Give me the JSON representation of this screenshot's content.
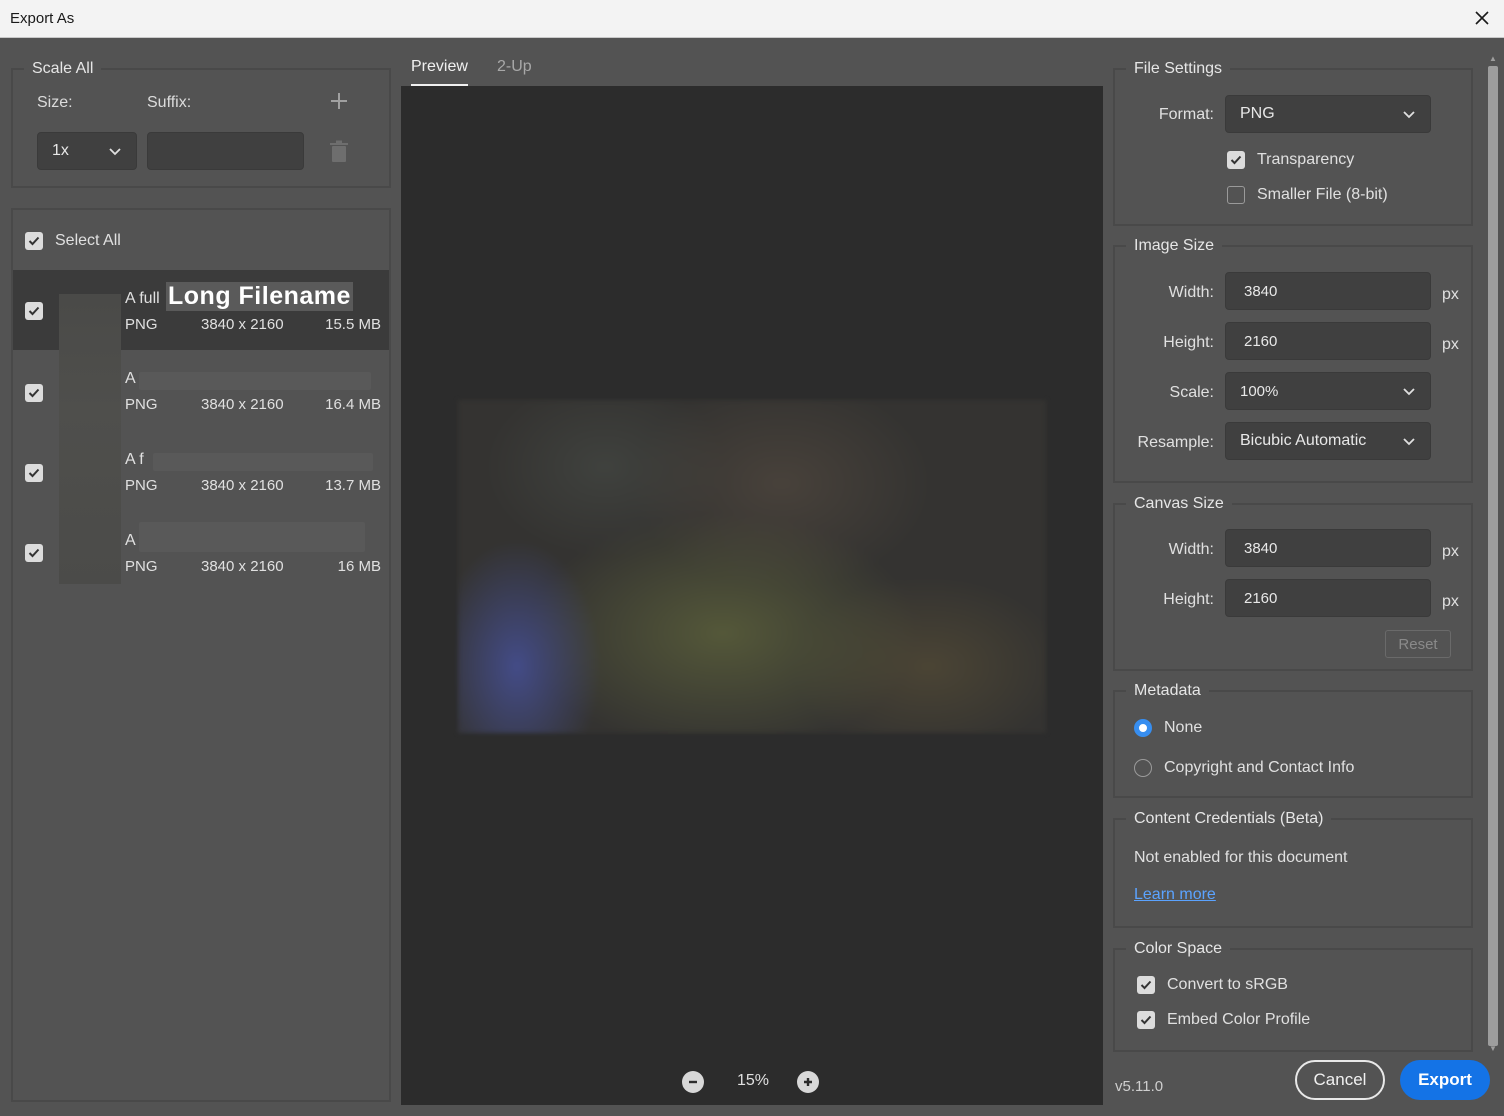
{
  "window": {
    "title": "Export As"
  },
  "scale_all": {
    "legend": "Scale All",
    "size_label": "Size:",
    "suffix_label": "Suffix:",
    "size_value": "1x",
    "suffix_value": ""
  },
  "file_list": {
    "select_all": "Select All",
    "files": [
      {
        "name_prefix": "A full",
        "name_highlight": "Long Filename",
        "format": "PNG",
        "dimensions": "3840 x 2160",
        "size": "15.5 MB"
      },
      {
        "name_prefix": "A",
        "format": "PNG",
        "dimensions": "3840 x 2160",
        "size": "16.4 MB"
      },
      {
        "name_prefix": "A f",
        "format": "PNG",
        "dimensions": "3840 x 2160",
        "size": "13.7 MB"
      },
      {
        "name_prefix": "A",
        "format": "PNG",
        "dimensions": "3840 x 2160",
        "size": "16 MB"
      }
    ]
  },
  "preview": {
    "tabs": [
      "Preview",
      "2-Up"
    ],
    "zoom": "15%"
  },
  "file_settings": {
    "legend": "File Settings",
    "format_label": "Format:",
    "format_value": "PNG",
    "transparency": "Transparency",
    "smaller_file": "Smaller File (8-bit)"
  },
  "image_size": {
    "legend": "Image Size",
    "width_label": "Width:",
    "width_value": "3840",
    "height_label": "Height:",
    "height_value": "2160",
    "scale_label": "Scale:",
    "scale_value": "100%",
    "resample_label": "Resample:",
    "resample_value": "Bicubic Automatic",
    "unit": "px"
  },
  "canvas_size": {
    "legend": "Canvas Size",
    "width_label": "Width:",
    "width_value": "3840",
    "height_label": "Height:",
    "height_value": "2160",
    "unit": "px",
    "reset": "Reset"
  },
  "metadata": {
    "legend": "Metadata",
    "none": "None",
    "copyright": "Copyright and Contact Info"
  },
  "content_credentials": {
    "legend": "Content Credentials (Beta)",
    "status": "Not enabled for this document",
    "learn_more": "Learn more"
  },
  "color_space": {
    "legend": "Color Space",
    "convert": "Convert to sRGB",
    "embed": "Embed Color Profile"
  },
  "footer": {
    "version": "v5.11.0",
    "cancel": "Cancel",
    "export": "Export"
  },
  "colors": {
    "accent": "#1473e6",
    "background": "#535353",
    "preview_bg": "#2c2c2c"
  }
}
